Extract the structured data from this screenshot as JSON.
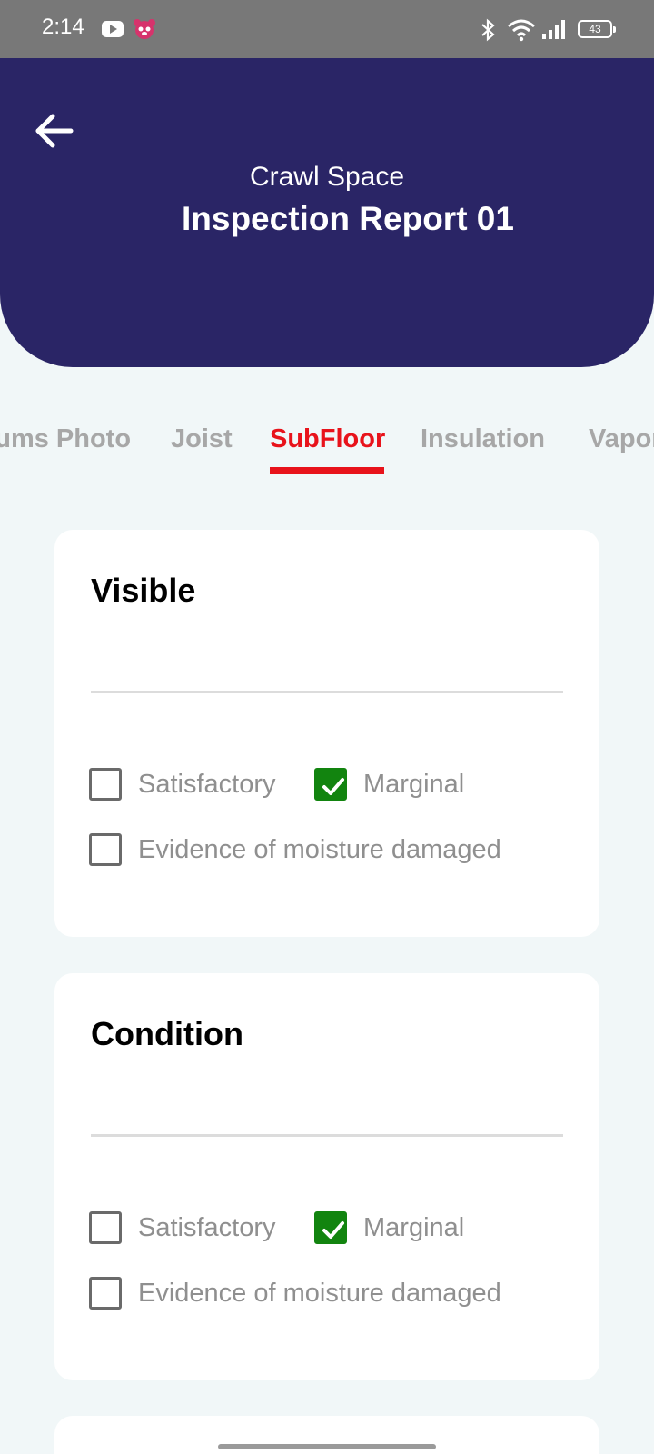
{
  "status_bar": {
    "time": "2:14",
    "battery": "43",
    "icons": [
      "youtube-icon",
      "panda-app-icon",
      "bluetooth-icon",
      "wifi-icon",
      "signal-icon",
      "battery-icon"
    ]
  },
  "header": {
    "subtitle": "Crawl Space",
    "title": "Inspection Report 01",
    "background_color": "#2a2566"
  },
  "tabs": [
    {
      "label": "Drums Photo"
    },
    {
      "label": "Joist"
    },
    {
      "label": "SubFloor",
      "active": true
    },
    {
      "label": "Insulation"
    },
    {
      "label": "Vapor"
    }
  ],
  "accent_color": "#e8131b",
  "checked_color": "#12840f",
  "sections": [
    {
      "title": "Visible",
      "input_value": "",
      "options": [
        {
          "label": "Satisfactory",
          "checked": false
        },
        {
          "label": "Marginal",
          "checked": true
        },
        {
          "label": "Evidence of moisture damaged",
          "checked": false
        }
      ]
    },
    {
      "title": "Condition",
      "input_value": "",
      "options": [
        {
          "label": "Satisfactory",
          "checked": false
        },
        {
          "label": "Marginal",
          "checked": true
        },
        {
          "label": "Evidence of moisture damaged",
          "checked": false
        }
      ]
    }
  ]
}
